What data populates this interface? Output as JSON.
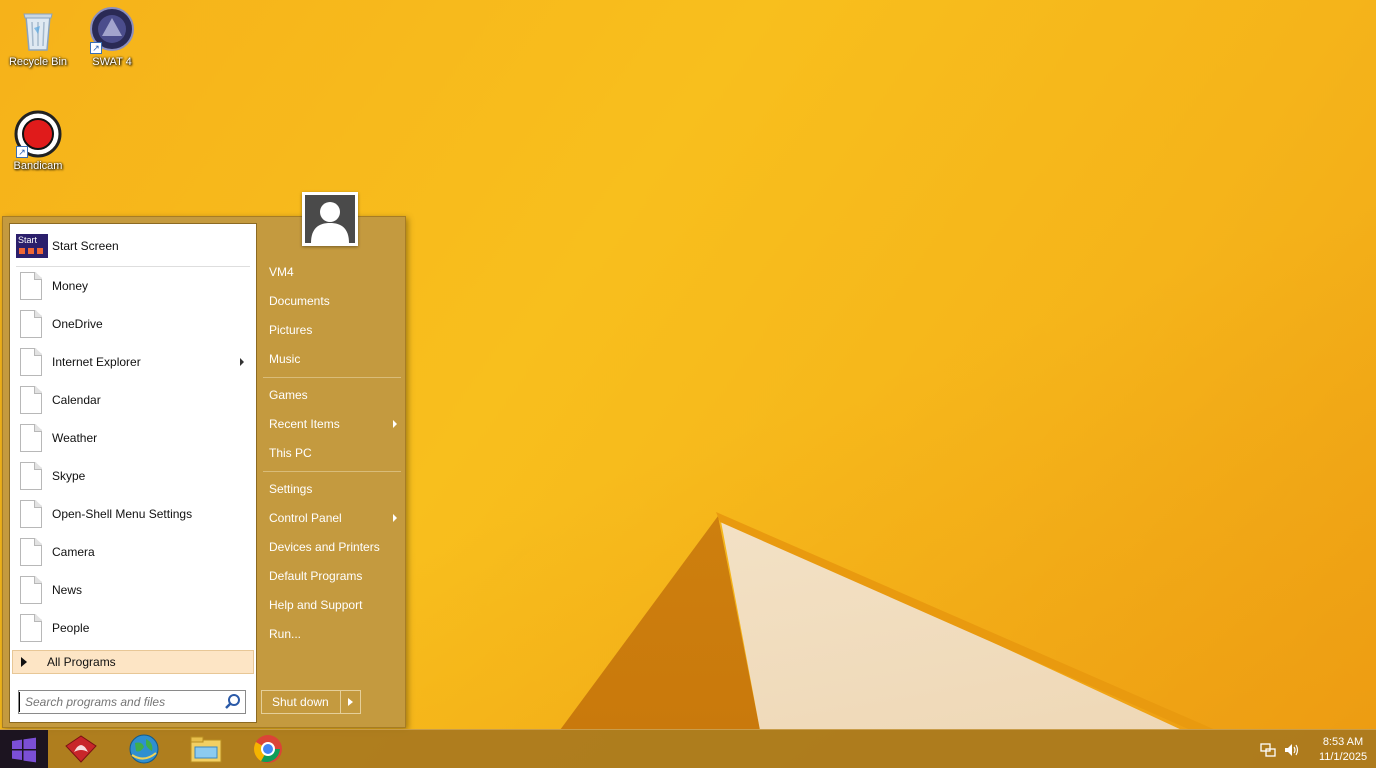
{
  "desktop": {
    "icons": [
      {
        "label": "Recycle Bin",
        "icon": "recycle-bin-icon"
      },
      {
        "label": "SWAT 4",
        "icon": "swat4-game-icon"
      },
      {
        "label": "Bandicam",
        "icon": "bandicam-record-icon"
      }
    ]
  },
  "start_menu": {
    "programs": [
      {
        "label": "Start Screen",
        "icon": "start-screen-icon"
      },
      {
        "label": "Money",
        "icon": "generic-app-icon"
      },
      {
        "label": "OneDrive",
        "icon": "generic-app-icon"
      },
      {
        "label": "Internet Explorer",
        "icon": "generic-app-icon",
        "submenu": true
      },
      {
        "label": "Calendar",
        "icon": "generic-app-icon"
      },
      {
        "label": "Weather",
        "icon": "generic-app-icon"
      },
      {
        "label": "Skype",
        "icon": "generic-app-icon"
      },
      {
        "label": "Open-Shell Menu Settings",
        "icon": "generic-app-icon"
      },
      {
        "label": "Camera",
        "icon": "generic-app-icon"
      },
      {
        "label": "News",
        "icon": "generic-app-icon"
      },
      {
        "label": "People",
        "icon": "generic-app-icon"
      }
    ],
    "start_screen_icon_text": "Start",
    "all_programs": "All Programs",
    "search": {
      "placeholder": "Search programs and files",
      "value": ""
    },
    "right_items": [
      {
        "label": "VM4"
      },
      {
        "label": "Documents"
      },
      {
        "label": "Pictures"
      },
      {
        "label": "Music"
      },
      {
        "label": "Games"
      },
      {
        "label": "Recent Items",
        "submenu": true
      },
      {
        "label": "This PC"
      },
      {
        "label": "Settings"
      },
      {
        "label": "Control Panel",
        "submenu": true
      },
      {
        "label": "Devices and Printers"
      },
      {
        "label": "Default Programs"
      },
      {
        "label": "Help and Support"
      },
      {
        "label": "Run..."
      }
    ],
    "shutdown_label": "Shut down"
  },
  "taskbar": {
    "apps": [
      "acrobat-app-icon",
      "globe-browser-icon",
      "file-explorer-icon",
      "chrome-icon"
    ],
    "clock": {
      "time": "8:53 AM",
      "date": "11/1/2025"
    },
    "tray_icons": [
      "network-icon",
      "volume-icon"
    ]
  },
  "colors": {
    "wallpaper": "#f8bf1d",
    "menu_right_pane": "#c49a3f",
    "taskbar": "#a8781e",
    "all_programs_highlight": "#fde5c5"
  }
}
